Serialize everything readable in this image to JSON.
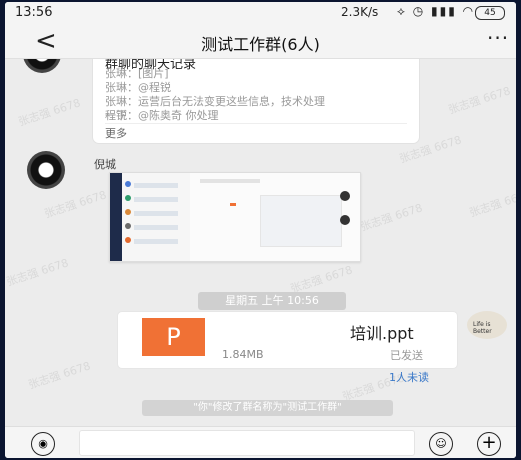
{
  "status_bar": {
    "time": "13:56",
    "net_rate": "2.3K/s",
    "battery": "45"
  },
  "header": {
    "back_icon": "chevron-left-icon",
    "title": "测试工作群(6人)",
    "more_icon": "ellipsis-icon"
  },
  "chat_record": {
    "title": "群聊的聊天记录",
    "lines": [
      "张琳：[图片]",
      "张琳：@程锐",
      "张琳：运营后台无法变更这些信息，技术处理一下",
      "程锐：@陈奥奇 你处理"
    ],
    "more": "更多"
  },
  "message_image": {
    "sender": "倪城"
  },
  "time_divider": "星期五 上午 10:56",
  "file_message": {
    "icon_letter": "P",
    "filename": "培训.ppt",
    "size": "1.84MB",
    "status": "已发送",
    "unread": "1人未读",
    "right_avatar_text": "Life is Better"
  },
  "system_message": "\"你\"修改了群名称为\"测试工作群\"",
  "watermarks": [
    "张志强 6678",
    "张志强 6678",
    "张志强 6678",
    "张志强 6678",
    "张志强 6678",
    "张志强 6678",
    "张志强 6678",
    "张志强 6678",
    "张志强 6678",
    "张志强 6678"
  ],
  "input_bar": {
    "voice_icon": "microphone-icon",
    "emoji_icon": "emoji-icon",
    "plus_icon": "plus-icon"
  },
  "colors": {
    "file_icon": "#f07135",
    "link": "#3a78c8",
    "frame": "#0b1530"
  }
}
